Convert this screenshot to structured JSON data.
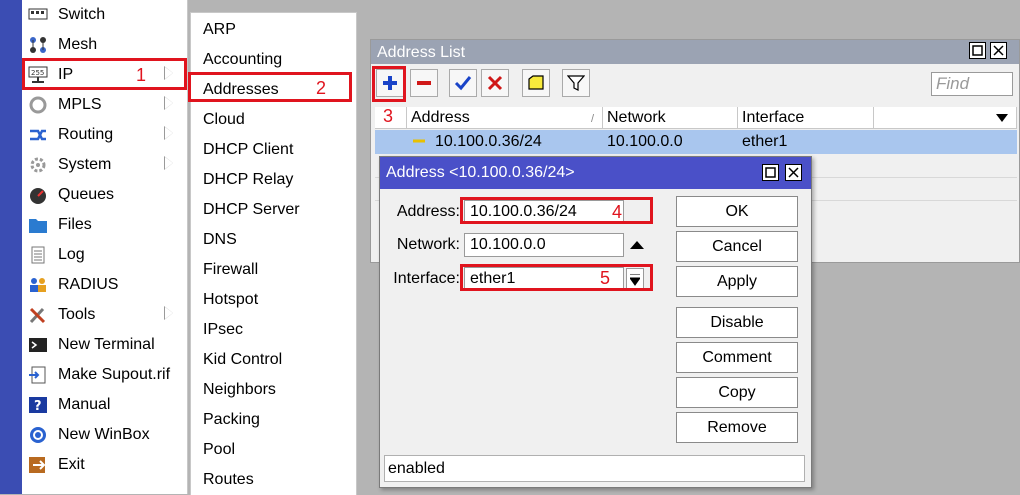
{
  "main_menu": {
    "items": [
      {
        "label": "Switch",
        "icon": "switch-icon"
      },
      {
        "label": "Mesh",
        "icon": "mesh-icon"
      },
      {
        "label": "IP",
        "icon": "ip-icon"
      },
      {
        "label": "MPLS",
        "icon": "mpls-icon"
      },
      {
        "label": "Routing",
        "icon": "routing-icon"
      },
      {
        "label": "System",
        "icon": "system-gear-icon"
      },
      {
        "label": "Queues",
        "icon": "queues-icon"
      },
      {
        "label": "Files",
        "icon": "folder-icon"
      },
      {
        "label": "Log",
        "icon": "log-icon"
      },
      {
        "label": "RADIUS",
        "icon": "radius-users-icon"
      },
      {
        "label": "Tools",
        "icon": "tools-icon"
      },
      {
        "label": "New Terminal",
        "icon": "terminal-icon"
      },
      {
        "label": "Make Supout.rif",
        "icon": "supout-icon"
      },
      {
        "label": "Manual",
        "icon": "manual-help-icon"
      },
      {
        "label": "New WinBox",
        "icon": "winbox-icon"
      },
      {
        "label": "Exit",
        "icon": "exit-icon"
      }
    ]
  },
  "ip_submenu": {
    "items": [
      "ARP",
      "Accounting",
      "Addresses",
      "Cloud",
      "DHCP Client",
      "DHCP Relay",
      "DHCP Server",
      "DNS",
      "Firewall",
      "Hotspot",
      "IPsec",
      "Kid Control",
      "Neighbors",
      "Packing",
      "Pool",
      "Routes"
    ]
  },
  "annotations": {
    "n1": "1",
    "n2": "2",
    "n3": "3",
    "n4": "4",
    "n5": "5"
  },
  "address_list": {
    "title": "Address List",
    "find_placeholder": "Find",
    "columns": [
      "Address",
      "Network",
      "Interface"
    ],
    "rows": [
      {
        "address": "10.100.0.36/24",
        "network": "10.100.0.0",
        "interface": "ether1"
      }
    ]
  },
  "dialog": {
    "title": "Address <10.100.0.36/24>",
    "address_label": "Address:",
    "address_value": "10.100.0.36/24",
    "network_label": "Network:",
    "network_value": "10.100.0.0",
    "interface_label": "Interface:",
    "interface_value": "ether1",
    "buttons": {
      "ok": "OK",
      "cancel": "Cancel",
      "apply": "Apply",
      "disable": "Disable",
      "comment": "Comment",
      "copy": "Copy",
      "remove": "Remove"
    },
    "status": "enabled"
  },
  "colors": {
    "accent_red": "#e0141e",
    "sidebar": "#3b4db3",
    "dialog_title": "#4a50c8",
    "selected_row": "#a9c6ee"
  }
}
